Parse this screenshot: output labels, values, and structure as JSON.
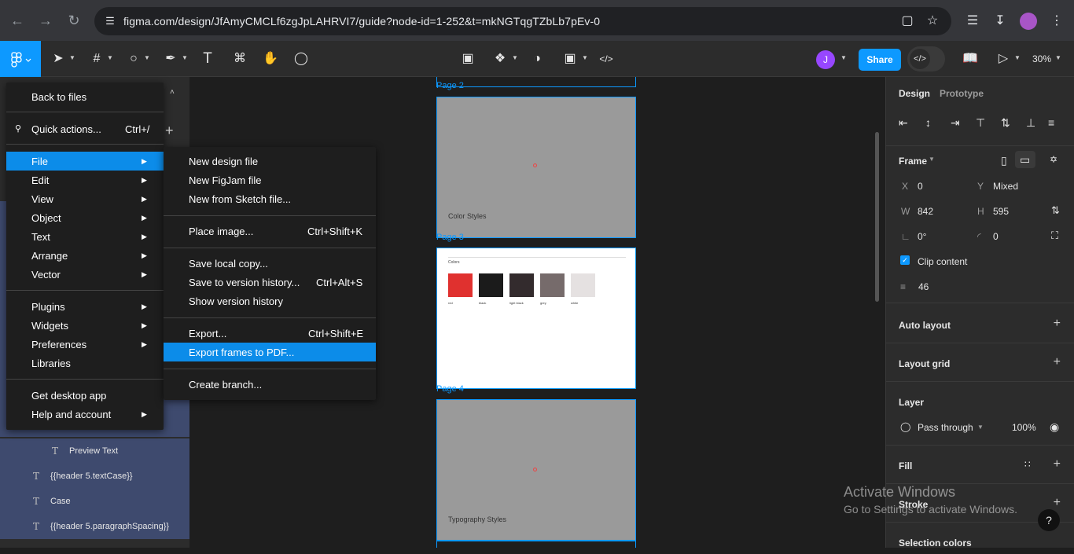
{
  "browser": {
    "url": "figma.com/design/JfAmyCMCLf6zgJpLAHRVI7/guide?node-id=1-252&t=mkNGTqgTZbLb7pEv-0"
  },
  "toolbar": {
    "share_label": "Share",
    "avatar_letter": "J",
    "zoom": "30%"
  },
  "main_menu": {
    "items": [
      {
        "label": "Back to files"
      },
      {
        "label": "Quick actions...",
        "shortcut": "Ctrl+/"
      },
      {
        "label": "File"
      },
      {
        "label": "Edit"
      },
      {
        "label": "View"
      },
      {
        "label": "Object"
      },
      {
        "label": "Text"
      },
      {
        "label": "Arrange"
      },
      {
        "label": "Vector"
      },
      {
        "label": "Plugins"
      },
      {
        "label": "Widgets"
      },
      {
        "label": "Preferences"
      },
      {
        "label": "Libraries"
      },
      {
        "label": "Get desktop app"
      },
      {
        "label": "Help and account"
      }
    ]
  },
  "file_menu": {
    "items": [
      {
        "label": "New design file"
      },
      {
        "label": "New FigJam file"
      },
      {
        "label": "New from Sketch file..."
      },
      {
        "label": "Place image...",
        "shortcut": "Ctrl+Shift+K"
      },
      {
        "label": "Save local copy..."
      },
      {
        "label": "Save to version history...",
        "shortcut": "Ctrl+Alt+S"
      },
      {
        "label": "Show version history"
      },
      {
        "label": "Export...",
        "shortcut": "Ctrl+Shift+E"
      },
      {
        "label": "Export frames to PDF..."
      },
      {
        "label": "Create branch..."
      }
    ]
  },
  "layers": {
    "items": [
      {
        "label": "Preview Text"
      },
      {
        "label": "{{header 5.textCase}}"
      },
      {
        "label": "Case"
      },
      {
        "label": "{{header 5.paragraphSpacing}}"
      }
    ]
  },
  "canvas": {
    "frames": [
      {
        "label": "Page 2",
        "caption": "Color Styles"
      },
      {
        "label": "Page 3",
        "caption": "Colors"
      },
      {
        "label": "Page 4",
        "caption": "Typography Styles"
      }
    ],
    "swatches": [
      {
        "name": "red",
        "color": "#e0312f"
      },
      {
        "name": "black",
        "color": "#1b1b1b"
      },
      {
        "name": "light black",
        "color": "#332b2d"
      },
      {
        "name": "grey",
        "color": "#766b6b"
      },
      {
        "name": "white",
        "color": "#e5e1e1"
      }
    ]
  },
  "design_panel": {
    "tabs": [
      "Design",
      "Prototype"
    ],
    "frame_label": "Frame",
    "x_key": "X",
    "x_val": "0",
    "y_key": "Y",
    "y_val": "Mixed",
    "w_key": "W",
    "w_val": "842",
    "h_key": "H",
    "h_val": "595",
    "rotation": "0°",
    "radius": "0",
    "clip_content": "Clip content",
    "spacing": "46",
    "auto_layout": "Auto layout",
    "layout_grid": "Layout grid",
    "layer": "Layer",
    "blend": "Pass through",
    "opacity": "100%",
    "fill": "Fill",
    "stroke": "Stroke",
    "selection_colors": "Selection colors"
  },
  "watermark": {
    "title": "Activate Windows",
    "subtitle": "Go to Settings to activate Windows."
  },
  "help_label": "?"
}
